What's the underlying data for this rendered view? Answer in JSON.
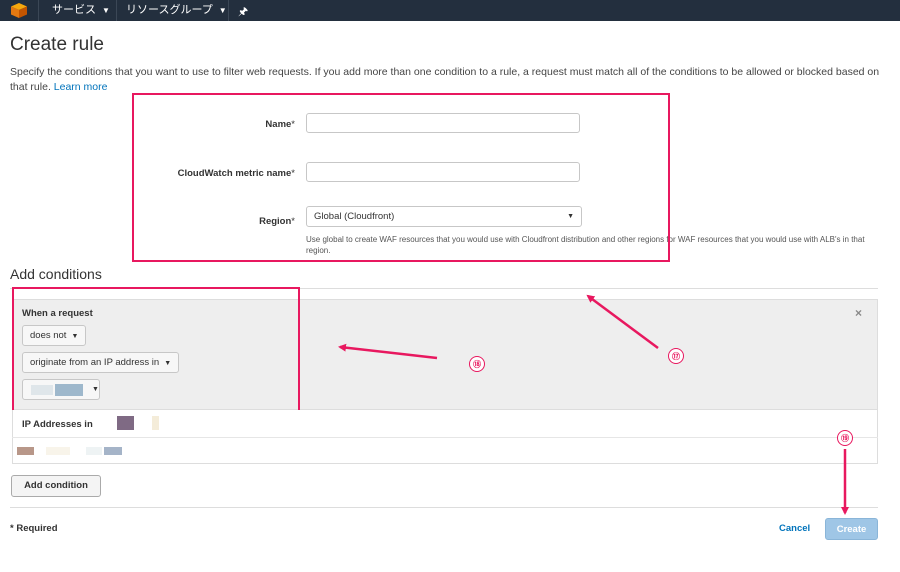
{
  "topbar": {
    "services": "サービス",
    "resource_groups": "リソースグループ",
    "pin": "🖈"
  },
  "page": {
    "title": "Create rule",
    "description": "Specify the conditions that you want to use to filter web requests. If you add more than one condition to a rule, a request must match all of the conditions to be allowed or blocked based on that rule.",
    "learn_more": "Learn more"
  },
  "form": {
    "name_label": "Name",
    "metric_label": "CloudWatch metric name",
    "region_label": "Region",
    "required_mark": "*",
    "region_value": "Global (Cloudfront)",
    "region_hint": "Use global to create WAF resources that you would use with Cloudfront distribution and other regions for WAF resources that you would use with ALB's in that region."
  },
  "conditions": {
    "heading": "Add conditions",
    "when": "When a request",
    "match_type": "does not",
    "condition_type": "originate from an IP address in",
    "ip_title": "IP Addresses in",
    "close": "×",
    "add_button": "Add condition"
  },
  "footer": {
    "required_note": "* Required",
    "cancel": "Cancel",
    "create": "Create"
  },
  "annotations": {
    "badge_17": "⑰",
    "badge_18": "⑱",
    "badge_19": "⑲",
    "color": "#e8185f"
  }
}
